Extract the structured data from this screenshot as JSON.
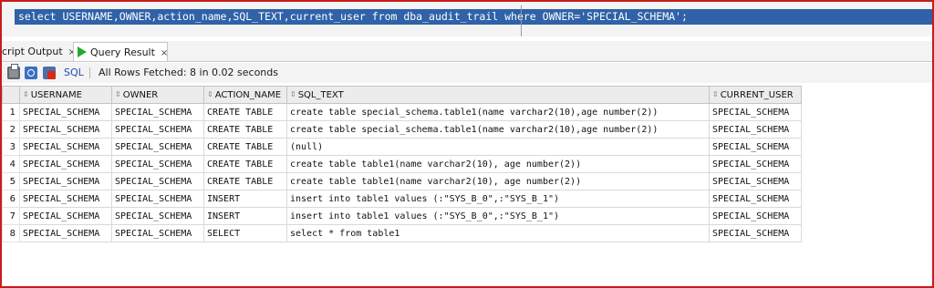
{
  "editor": {
    "query": "select USERNAME,OWNER,action_name,SQL_TEXT,current_user from dba_audit_trail where OWNER='SPECIAL_SCHEMA';"
  },
  "tabs": {
    "script_output": "cript Output",
    "query_result": "Query Result",
    "close_glyph": "×"
  },
  "toolbar": {
    "sql_link": "SQL",
    "status": "All Rows Fetched: 8 in 0.02 seconds",
    "icons": [
      "print-icon",
      "refresh-icon",
      "delete-icon"
    ]
  },
  "grid": {
    "sort_glyph": "⇕",
    "columns": [
      "USERNAME",
      "OWNER",
      "ACTION_NAME",
      "SQL_TEXT",
      "CURRENT_USER"
    ],
    "rows": [
      {
        "n": "1",
        "username": "SPECIAL_SCHEMA",
        "owner": "SPECIAL_SCHEMA",
        "action": "CREATE TABLE",
        "sql": "create table special_schema.table1(name varchar2(10),age number(2))",
        "current_user": "SPECIAL_SCHEMA"
      },
      {
        "n": "2",
        "username": "SPECIAL_SCHEMA",
        "owner": "SPECIAL_SCHEMA",
        "action": "CREATE TABLE",
        "sql": "create table special_schema.table1(name varchar2(10),age number(2))",
        "current_user": "SPECIAL_SCHEMA"
      },
      {
        "n": "3",
        "username": "SPECIAL_SCHEMA",
        "owner": "SPECIAL_SCHEMA",
        "action": "CREATE TABLE",
        "sql": "(null)",
        "current_user": "SPECIAL_SCHEMA"
      },
      {
        "n": "4",
        "username": "SPECIAL_SCHEMA",
        "owner": "SPECIAL_SCHEMA",
        "action": "CREATE TABLE",
        "sql": "create table table1(name varchar2(10), age number(2))",
        "current_user": "SPECIAL_SCHEMA"
      },
      {
        "n": "5",
        "username": "SPECIAL_SCHEMA",
        "owner": "SPECIAL_SCHEMA",
        "action": "CREATE TABLE",
        "sql": "create table table1(name varchar2(10), age number(2))",
        "current_user": "SPECIAL_SCHEMA"
      },
      {
        "n": "6",
        "username": "SPECIAL_SCHEMA",
        "owner": "SPECIAL_SCHEMA",
        "action": "INSERT",
        "sql": "insert into table1 values (:\"SYS_B_0\",:\"SYS_B_1\")",
        "current_user": "SPECIAL_SCHEMA"
      },
      {
        "n": "7",
        "username": "SPECIAL_SCHEMA",
        "owner": "SPECIAL_SCHEMA",
        "action": "INSERT",
        "sql": "insert into table1 values (:\"SYS_B_0\",:\"SYS_B_1\")",
        "current_user": "SPECIAL_SCHEMA"
      },
      {
        "n": "8",
        "username": "SPECIAL_SCHEMA",
        "owner": "SPECIAL_SCHEMA",
        "action": "SELECT",
        "sql": "select * from table1",
        "current_user": "SPECIAL_SCHEMA"
      }
    ]
  },
  "colors": {
    "frame_border": "#c81c1c",
    "editor_selection": "#2f62a8",
    "run_icon_green": "#2aa830",
    "sql_link": "#1f4fb4"
  }
}
